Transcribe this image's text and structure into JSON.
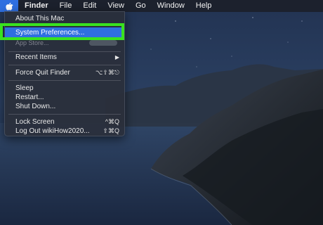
{
  "menubar": {
    "apple_icon": "apple-logo-icon",
    "items": [
      "Finder",
      "File",
      "Edit",
      "View",
      "Go",
      "Window",
      "Help"
    ]
  },
  "apple_menu": {
    "about": "About This Mac",
    "system_preferences": "System Preferences...",
    "app_store_partial": "App Store...",
    "recent_items": "Recent Items",
    "recent_items_arrow": "▶",
    "force_quit": "Force Quit Finder",
    "force_quit_shortcut": "⌥⇧⌘⎋",
    "sleep": "Sleep",
    "restart": "Restart...",
    "shut_down": "Shut Down...",
    "lock_screen": "Lock Screen",
    "lock_screen_shortcut": "^⌘Q",
    "log_out": "Log Out wikiHow2020...",
    "log_out_shortcut": "⇧⌘Q"
  },
  "colors": {
    "selection": "#2f6fe0",
    "highlight_annotation": "#39e21f",
    "menu_background": "#2a2f3a"
  }
}
